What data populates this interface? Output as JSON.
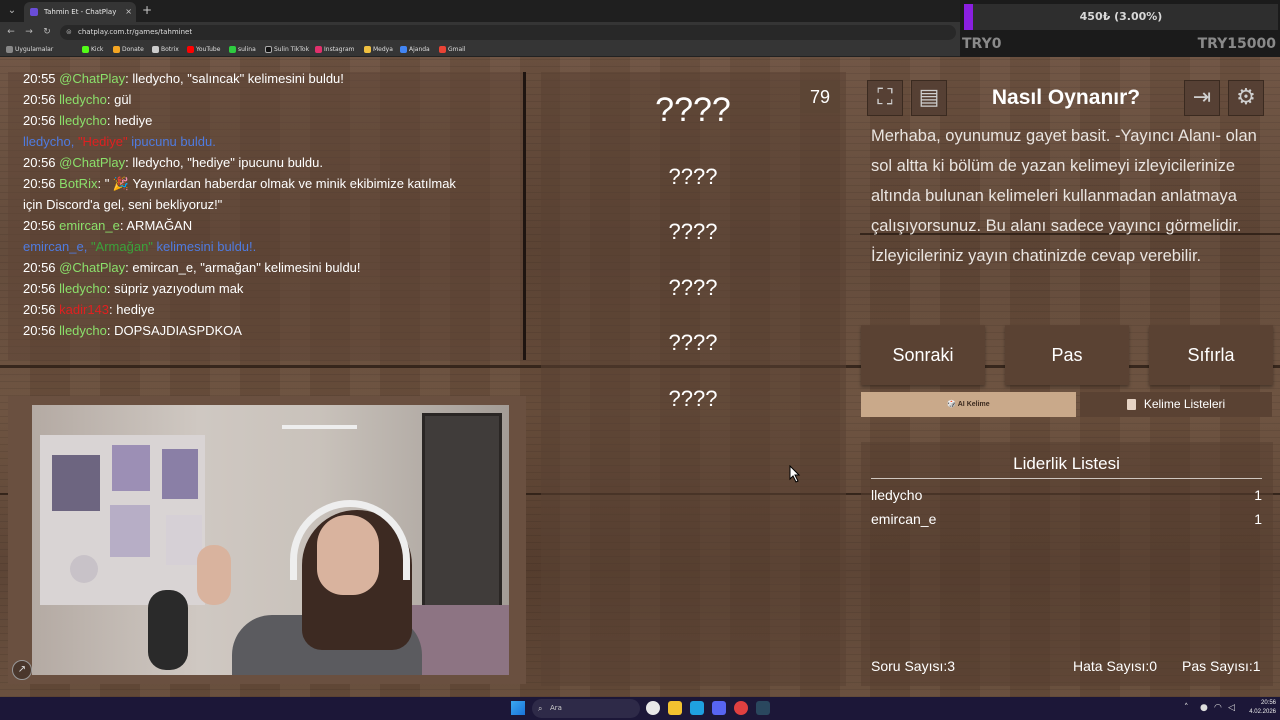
{
  "browser": {
    "tab_title": "Tahmin Et - ChatPlay",
    "tab_close": "×",
    "new_tab": "+",
    "url": "chatplay.com.tr/games/tahminet",
    "bookmarks": [
      "Uygulamalar",
      "Kick",
      "Donate",
      "Botrix",
      "YouTube",
      "sulina",
      "Sulin TikTok",
      "Instagram",
      "Medya",
      "Ajanda",
      "Gmail"
    ]
  },
  "donation": {
    "amount_label": "450₺ (3.00%)",
    "progress_percent": 3,
    "min_label": "TRY0",
    "max_label": "TRY15000",
    "fill_color": "#8a1fe0"
  },
  "chat": {
    "lines": [
      {
        "time": "20:55",
        "user": "@ChatPlay",
        "text": ": lledycho, \"salıncak\" kelimesini buldu!"
      },
      {
        "time": "20:56",
        "user": "lledycho",
        "text": ": gül"
      },
      {
        "time": "20:56",
        "user": "lledycho",
        "text": ": hediye"
      },
      {
        "sys_user": "lledycho,",
        "sys_word": "\"Hediye\"",
        "sys_text": " ipucunu buldu."
      },
      {
        "time": "20:56",
        "user": "@ChatPlay",
        "text": ": lledycho, \"hediye\" ipucunu buldu."
      },
      {
        "time": "20:56",
        "user": "BotRix",
        "text": ": \" 🎉  Yayınlardan haberdar olmak ve minik ekibimize katılmak"
      },
      {
        "cont": "için Discord'a gel, seni bekliyoruz!\""
      },
      {
        "time": "20:56",
        "user": "emircan_e",
        "text": ": ARMAĞAN"
      },
      {
        "sys_user": "emircan_e,",
        "sys_word": "\"Armağan\"",
        "sys_text": " kelimesini buldu!."
      },
      {
        "time": "20:56",
        "user": "@ChatPlay",
        "text": ": emircan_e, \"armağan\" kelimesini buldu!"
      },
      {
        "time": "20:56",
        "user": "lledycho",
        "text": ": süpriz yazıyodum mak"
      },
      {
        "time": "20:56",
        "user_red": "kadir143",
        "text": ": hediye"
      },
      {
        "time": "20:56",
        "user": "lledycho",
        "text": ": DOPSAJDIASPDKOA"
      }
    ]
  },
  "game": {
    "timer": "79",
    "main_word": "????",
    "hints": [
      "????",
      "????",
      "????",
      "????",
      "????"
    ]
  },
  "how_to": {
    "title": "Nasıl Oynanır?",
    "text": "Merhaba, oyunumuz gayet basit. -Yayıncı Alanı- olan sol altta ki bölüm de yazan kelimeyi izleyicilerinize altında bulunan kelimeleri kullanmadan anlatmaya çalışıyorsunuz. Bu alanı sadece yayıncı görmelidir. İzleyicileriniz yayın chatinizde cevap verebilir.",
    "icons": [
      "fullscreen-icon",
      "notes-icon",
      "exit-icon",
      "gear-icon"
    ]
  },
  "controls": {
    "next": "Sonraki",
    "pass": "Pas",
    "reset": "Sıfırla",
    "ai_word": "🎲 AI Kelime",
    "word_lists": "Kelime Listeleri"
  },
  "leaderboard": {
    "title": "Liderlik Listesi",
    "rows": [
      {
        "name": "lledycho",
        "score": "1"
      },
      {
        "name": "emircan_e",
        "score": "1"
      }
    ]
  },
  "stats": {
    "questions": "Soru Sayısı:3",
    "errors": "Hata Sayısı:0",
    "passes": "Pas Sayısı:1"
  },
  "taskbar": {
    "search_placeholder": "Ara",
    "time": "20:56",
    "date": "4.02.2026"
  }
}
